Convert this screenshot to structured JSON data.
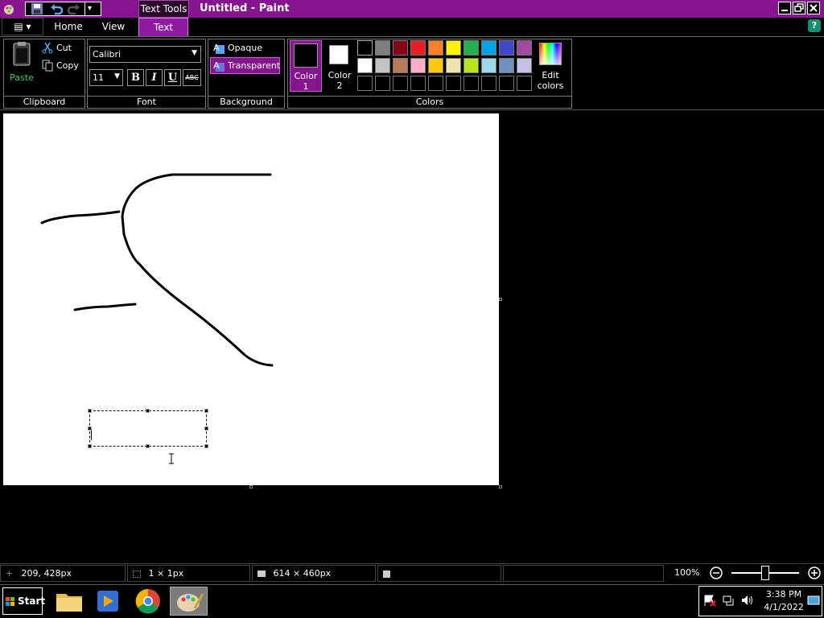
{
  "window": {
    "context_tab": "Text Tools",
    "title": "Untitled - Paint",
    "min_icon": "minimize-icon",
    "max_icon": "restore-icon",
    "close_icon": "close-icon"
  },
  "tabs": {
    "file": "▤ ▾",
    "home": "Home",
    "view": "View",
    "text": "Text"
  },
  "help": "?",
  "clipboard": {
    "paste": "Paste",
    "cut": "Cut",
    "copy": "Copy",
    "label": "Clipboard"
  },
  "font": {
    "family": "Calibri",
    "size": "11",
    "bold": "B",
    "italic": "I",
    "underline": "U",
    "strike": "ABC",
    "label": "Font"
  },
  "background": {
    "opaque": "Opaque",
    "transparent": "Transparent",
    "label": "Background"
  },
  "colors": {
    "color1_a": "Color",
    "color1_b": "1",
    "color2_a": "Color",
    "color2_b": "2",
    "edit_a": "Edit",
    "edit_b": "colors",
    "label": "Colors",
    "color1": "#000000",
    "color2": "#ffffff",
    "row1": [
      "#000000",
      "#7f7f7f",
      "#880015",
      "#ed1c24",
      "#ff7f27",
      "#fff200",
      "#22b14c",
      "#00a2e8",
      "#3f48cc",
      "#a349a4"
    ],
    "row2": [
      "#ffffff",
      "#c3c3c3",
      "#b97a57",
      "#ffaec9",
      "#ffc90e",
      "#efe4b0",
      "#b5e61d",
      "#99d9ea",
      "#7092be",
      "#c8bfe7"
    ]
  },
  "status": {
    "position": "209, 428px",
    "selection": "1 × 1px",
    "size": "614 × 460px",
    "zoom": "100%",
    "zoom_level": 0.5
  },
  "taskbar": {
    "start": "Start",
    "time": "3:38 PM",
    "date": "4/1/2022"
  },
  "accent": "#86148f"
}
